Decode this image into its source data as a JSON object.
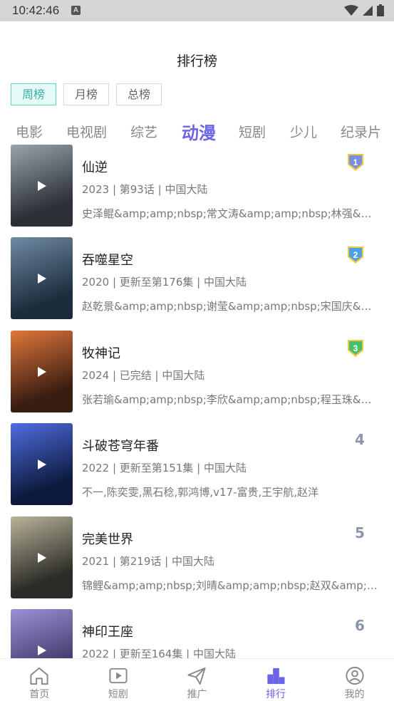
{
  "status_bar": {
    "time": "10:42:46",
    "badge": "A",
    "icons": [
      "wifi-icon",
      "signal-icon",
      "battery-icon"
    ]
  },
  "header": {
    "title": "排行榜"
  },
  "period_tabs": [
    {
      "label": "周榜",
      "active": true
    },
    {
      "label": "月榜",
      "active": false
    },
    {
      "label": "总榜",
      "active": false
    }
  ],
  "categories": [
    {
      "label": "电影",
      "active": false
    },
    {
      "label": "电视剧",
      "active": false
    },
    {
      "label": "综艺",
      "active": false
    },
    {
      "label": "动漫",
      "active": true
    },
    {
      "label": "短剧",
      "active": false
    },
    {
      "label": "少儿",
      "active": false
    },
    {
      "label": "纪录片",
      "active": false
    }
  ],
  "items": [
    {
      "rank": "1",
      "title": "仙逆",
      "meta": "2023 | 第93话 | 中国大陆",
      "cast": "史泽鲲&amp;amp;nbsp;常文涛&amp;amp;nbsp;林强&amp;amp;nbsp;",
      "rank_style": "badge",
      "badge_color": "#7b8fdc"
    },
    {
      "rank": "2",
      "title": "吞噬星空",
      "meta": "2020 | 更新至第176集 | 中国大陆",
      "cast": "赵乾景&amp;amp;nbsp;谢莹&amp;amp;nbsp;宋国庆&amp;amp;nbsp;",
      "rank_style": "badge",
      "badge_color": "#4f9fe6"
    },
    {
      "rank": "3",
      "title": "牧神记",
      "meta": "2024 | 已完结 | 中国大陆",
      "cast": "张若瑜&amp;amp;nbsp;李欣&amp;amp;nbsp;程玉珠&amp;amp;nbsp;",
      "rank_style": "badge",
      "badge_color": "#46c06a"
    },
    {
      "rank": "4",
      "title": "斗破苍穹年番",
      "meta": "2022 | 更新至第151集 | 中国大陆",
      "cast": "不一,陈奕雯,黑石稔,郭鸿博,v17-富贵,王宇航,赵洋",
      "rank_style": "number",
      "badge_color": ""
    },
    {
      "rank": "5",
      "title": "完美世界",
      "meta": "2021 | 第219话 | 中国大陆",
      "cast": "锦鲤&amp;amp;nbsp;刘晴&amp;amp;nbsp;赵双&amp;amp;nbsp;",
      "rank_style": "number",
      "badge_color": ""
    },
    {
      "rank": "6",
      "title": "神印王座",
      "meta": "2022 | 更新至164集 | 中国大陆",
      "cast": "",
      "rank_style": "number",
      "badge_color": ""
    }
  ],
  "poster_colors": [
    [
      "#2b2f36",
      "#9aa3ad"
    ],
    [
      "#1d2c3c",
      "#6f8aa4"
    ],
    [
      "#3a1d12",
      "#e0773a"
    ],
    [
      "#0d1a3d",
      "#4f6de0"
    ],
    [
      "#2a2a26",
      "#b9b39a"
    ],
    [
      "#3c3564",
      "#9d8fd6"
    ]
  ],
  "tabbar": [
    {
      "label": "首页",
      "icon": "home-icon",
      "active": false
    },
    {
      "label": "短剧",
      "icon": "video-icon",
      "active": false
    },
    {
      "label": "推广",
      "icon": "send-icon",
      "active": false
    },
    {
      "label": "排行",
      "icon": "ranking-icon",
      "active": true
    },
    {
      "label": "我的",
      "icon": "user-icon",
      "active": false
    }
  ]
}
